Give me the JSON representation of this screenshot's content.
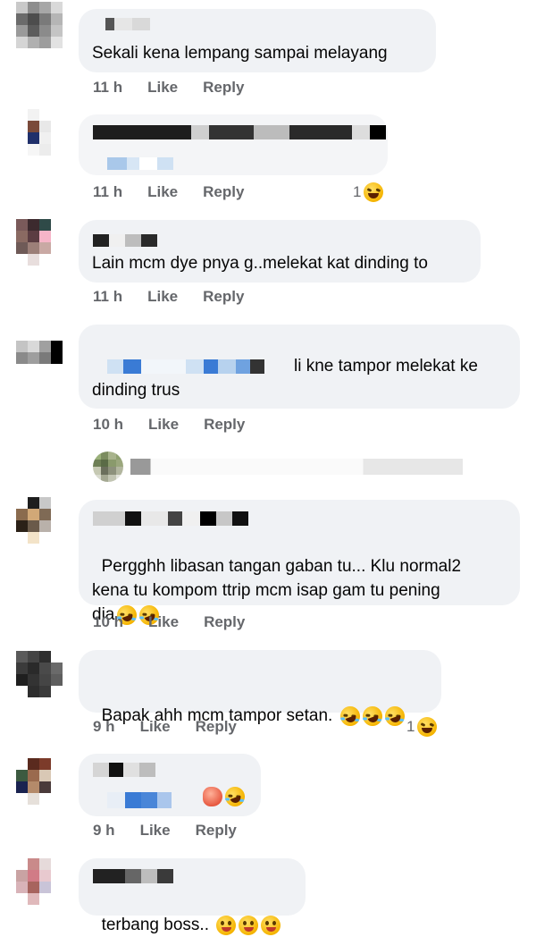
{
  "comments": [
    {
      "text": "Sekali kena lempang sampai melayang",
      "time": "11 h",
      "like": "Like",
      "reply": "Reply"
    },
    {
      "text": "",
      "time": "11 h",
      "like": "Like",
      "reply": "Reply",
      "reaction_count": "1"
    },
    {
      "text": "Lain mcm dye pnya g..melekat kat dinding to",
      "time": "11 h",
      "like": "Like",
      "reply": "Reply"
    },
    {
      "text": "li kne tampor melekat ke\ndinding trus",
      "time": "10 h",
      "like": "Like",
      "reply": "Reply"
    },
    {
      "text": "Pergghh libasan tangan gaban tu... Klu normal2\nkena tu kompom ttrip mcm isap gam tu pening\ndia",
      "time": "10 h",
      "like": "Like",
      "reply": "Reply"
    },
    {
      "text": "Bapak ahh mcm tampor setan.",
      "time": "9 h",
      "like": "Like",
      "reply": "Reply",
      "reaction_count": "1"
    },
    {
      "text": "",
      "time": "9 h",
      "like": "Like",
      "reply": "Reply"
    },
    {
      "text": "terbang boss..",
      "time": "",
      "like": "",
      "reply": ""
    }
  ],
  "icons": {
    "laugh": "laughing-face-emoji",
    "cry_laugh": "face-with-tears-of-joy-emoji",
    "wink": "winking-tongue-emoji"
  },
  "colors": {
    "bubble": "#f0f2f5",
    "meta_text": "#65676b",
    "redaction_blue": "#3a7bd5",
    "redaction_dark": "#222222"
  }
}
